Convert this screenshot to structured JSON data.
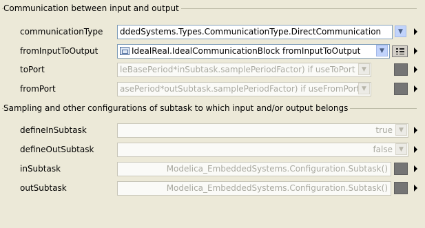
{
  "groups": [
    {
      "title": "Communication between input and output"
    },
    {
      "title": "Sampling and other configurations of subtask to which input and/or output belongs"
    }
  ],
  "params": [
    {
      "label": "communicationType",
      "value": "ddedSystems.Types.CommunicationType.DirectCommunication",
      "enabled": true,
      "control": "dropdown"
    },
    {
      "label": "fromInputToOutput",
      "value": "IdealReal.IdealCommunicationBlock fromInputToOutput",
      "enabled": true,
      "control": "dropdown+menu",
      "icon": "component-icon"
    },
    {
      "label": "toPort",
      "value": "leBasePeriod*inSubtask.samplePeriodFactor) if useToPort",
      "enabled": false,
      "control": "dropdown+square"
    },
    {
      "label": "fromPort",
      "value": "asePeriod*outSubtask.samplePeriodFactor) if useFromPort",
      "enabled": false,
      "control": "dropdown+square"
    },
    {
      "label": "defineInSubtask",
      "value": "true",
      "enabled": false,
      "control": "dropdown"
    },
    {
      "label": "defineOutSubtask",
      "value": "false",
      "enabled": false,
      "control": "dropdown"
    },
    {
      "label": "inSubtask",
      "value": "Modelica_EmbeddedSystems.Configuration.Subtask()",
      "enabled": false,
      "control": "square"
    },
    {
      "label": "outSubtask",
      "value": "Modelica_EmbeddedSystems.Configuration.Subtask()",
      "enabled": false,
      "control": "square"
    }
  ],
  "icons": {
    "dropdown": "chevron-down-icon",
    "menu": "list-menu-icon",
    "edit": "edit-square-icon",
    "more": "triangle-right-icon"
  },
  "colors": {
    "background": "#ece9d8",
    "field_border": "#7f9db9",
    "disabled_text": "#a9a9a0",
    "square_button": "#757575"
  }
}
